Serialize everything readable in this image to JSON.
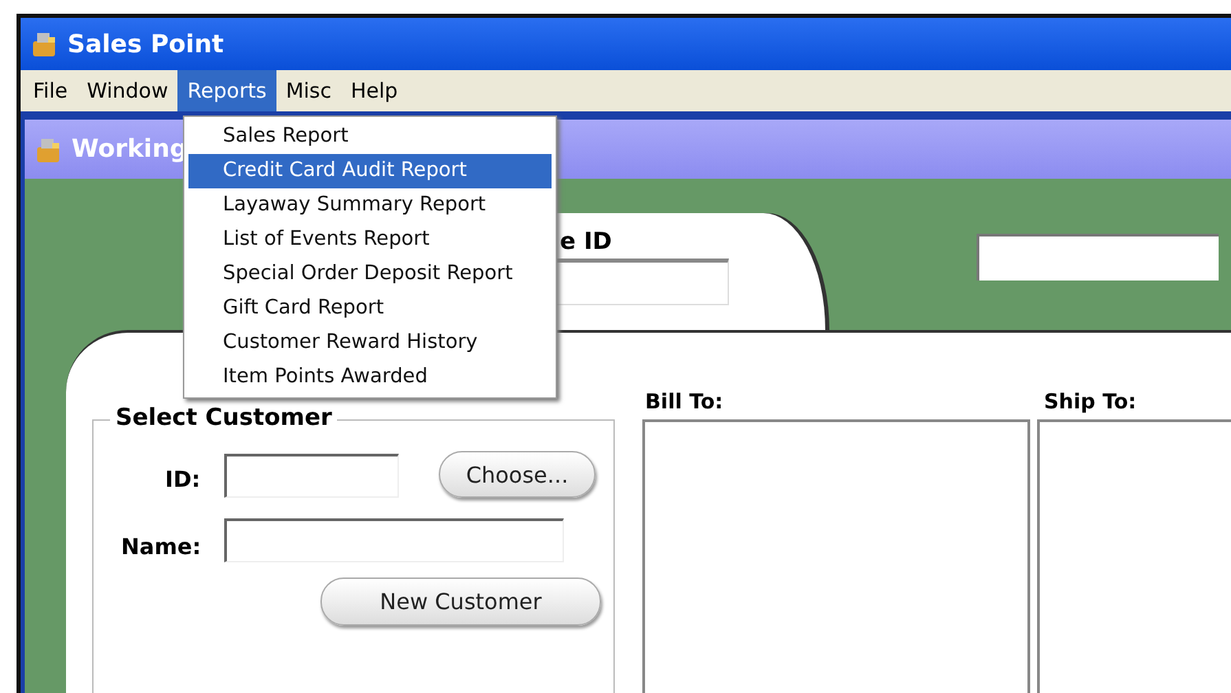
{
  "window": {
    "title": "Sales Point"
  },
  "menu": [
    {
      "label": "File",
      "selected": false
    },
    {
      "label": "Window",
      "selected": false
    },
    {
      "label": "Reports",
      "selected": true
    },
    {
      "label": "Misc",
      "selected": false
    },
    {
      "label": "Help",
      "selected": false
    }
  ],
  "reports_menu": [
    {
      "label": "Sales Report",
      "selected": false
    },
    {
      "label": "Credit Card Audit Report",
      "selected": true
    },
    {
      "label": "Layaway Summary Report",
      "selected": false
    },
    {
      "label": "List of Events Report",
      "selected": false
    },
    {
      "label": "Special Order Deposit Report",
      "selected": false
    },
    {
      "label": "Gift Card Report",
      "selected": false
    },
    {
      "label": "Customer Reward History",
      "selected": false
    },
    {
      "label": "Item Points Awarded",
      "selected": false
    }
  ],
  "inner_window": {
    "title": "Working"
  },
  "header": {
    "label": "e ID"
  },
  "select_customer": {
    "title": "Select Customer",
    "id_label": "ID:",
    "name_label": "Name:",
    "choose_button": "Choose...",
    "new_button": "New Customer"
  },
  "bill_to": {
    "label": "Bill To:"
  },
  "ship_to": {
    "label": "Ship To:"
  }
}
